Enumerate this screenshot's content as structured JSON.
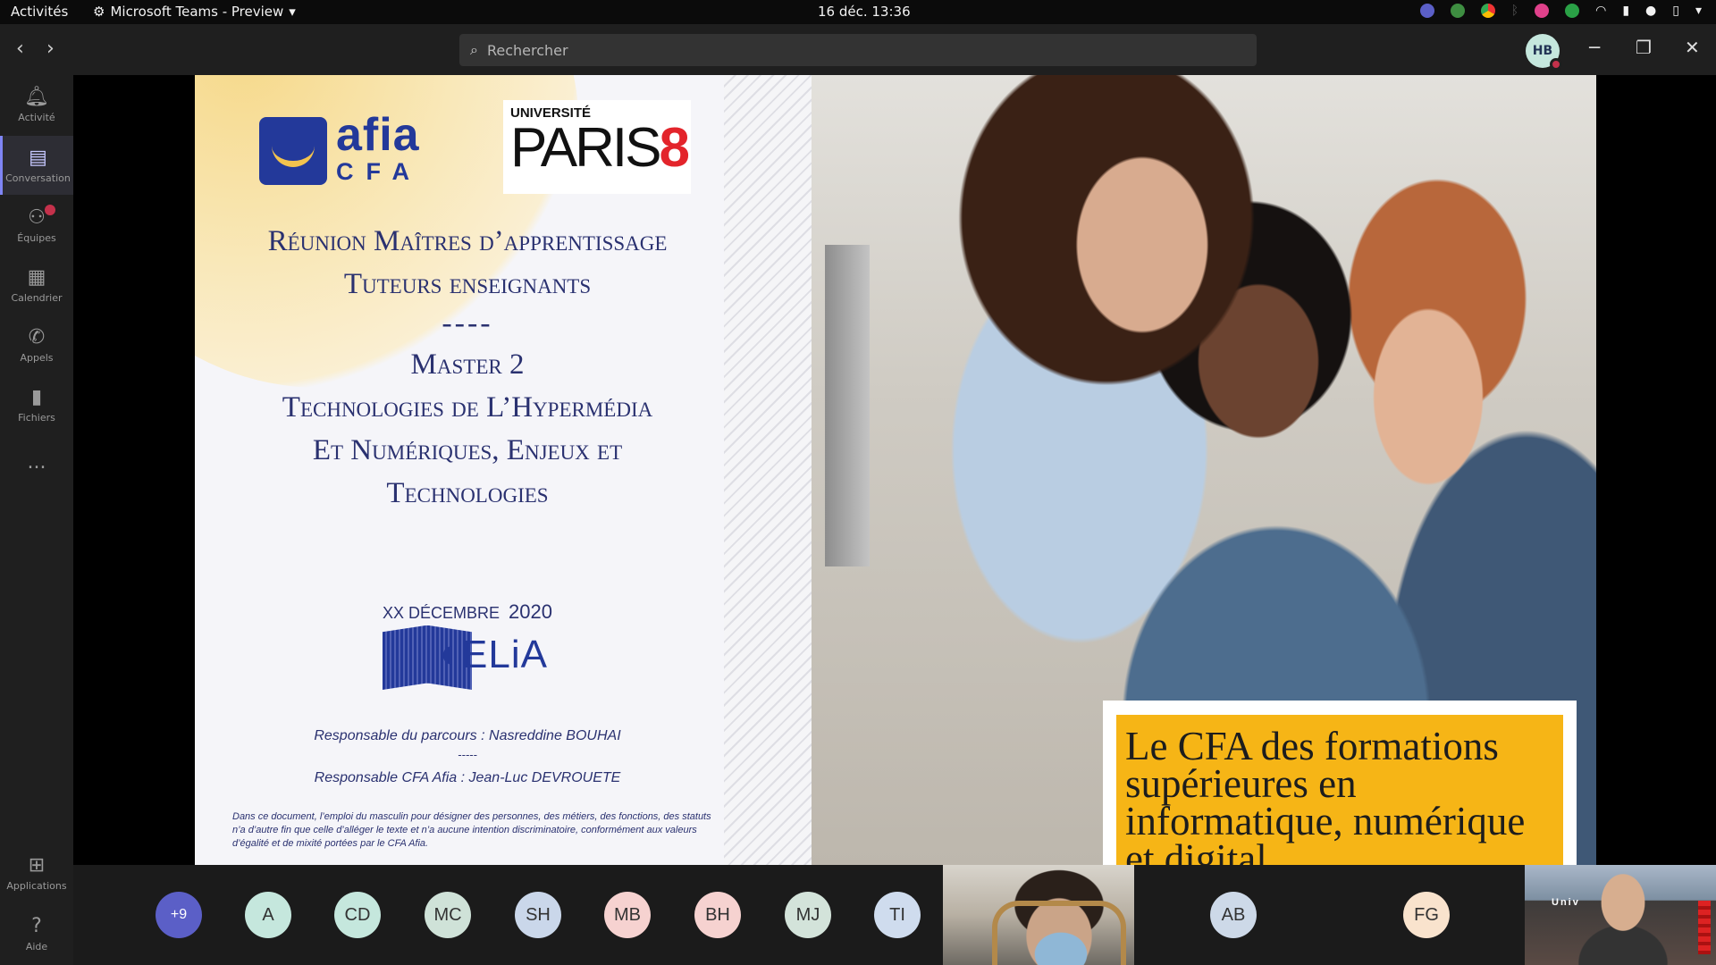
{
  "topbar": {
    "activities": "Activités",
    "app_menu": "Microsoft Teams - Preview",
    "clock": "16 déc.  13:36"
  },
  "titlebar": {
    "search_placeholder": "Rechercher",
    "user_initials": "HB"
  },
  "rail": {
    "items": [
      {
        "label": "Activité",
        "icon": "bell-icon"
      },
      {
        "label": "Conversation",
        "icon": "chat-icon"
      },
      {
        "label": "Équipes",
        "icon": "teams-icon"
      },
      {
        "label": "Calendrier",
        "icon": "calendar-icon"
      },
      {
        "label": "Appels",
        "icon": "phone-icon"
      },
      {
        "label": "Fichiers",
        "icon": "file-icon"
      },
      {
        "label": "...",
        "icon": "more-icon"
      }
    ],
    "bottom": [
      {
        "label": "Applications",
        "icon": "apps-icon"
      },
      {
        "label": "Aide",
        "icon": "help-icon"
      }
    ]
  },
  "slide": {
    "logo_afia_big": "afia",
    "logo_afia_small": "CFA",
    "logo_paris_univ": "UNIVERSITÉ",
    "logo_paris_text": "PARIS",
    "logo_paris_num": "8",
    "title_line1": "Réunion Maîtres d’apprentissage",
    "title_line2": "Tuteurs enseignants",
    "separator": "----",
    "subtitle_line1": "Master 2",
    "subtitle_line2": "Technologies de L’Hypermédia",
    "subtitle_line3": "Et Numériques, Enjeux et",
    "subtitle_line4": "Technologies",
    "date": "XX DÉCEMBRE",
    "year": "2020",
    "celia_logo_text": "ELiA",
    "responsable_parcours": "Responsable du parcours : Nasreddine BOUHAI",
    "resp_separator": "-----",
    "responsable_cfa": "Responsable CFA Afia : Jean-Luc DEVROUETE",
    "disclaimer": "Dans ce document, l’emploi du masculin pour désigner des personnes, des métiers, des fonctions, des statuts n’a d’autre fin que celle d’alléger le texte et n’a aucune intention discriminatoire, conformément aux valeurs d’égalité et de mixité portées par le CFA Afia.",
    "caption": " Le CFA des formations supérieures en informatique, numérique et digital_"
  },
  "participants": [
    {
      "initials": "+9",
      "color": "#5b5fc7"
    },
    {
      "initials": "A",
      "color": "#c5e7dd"
    },
    {
      "initials": "CD",
      "color": "#c5e7dd"
    },
    {
      "initials": "MC",
      "color": "#cfe2d8"
    },
    {
      "initials": "SH",
      "color": "#cad7ea"
    },
    {
      "initials": "MB",
      "color": "#f6d2d0"
    },
    {
      "initials": "BH",
      "color": "#f6d2d0"
    },
    {
      "initials": "MJ",
      "color": "#d3e3da"
    },
    {
      "initials": "TI",
      "color": "#cfdcee"
    },
    {
      "initials": "AB",
      "color": "#cdd9e8"
    },
    {
      "initials": "FG",
      "color": "#f9e3cd"
    }
  ],
  "video_tile_sign": "Univ"
}
